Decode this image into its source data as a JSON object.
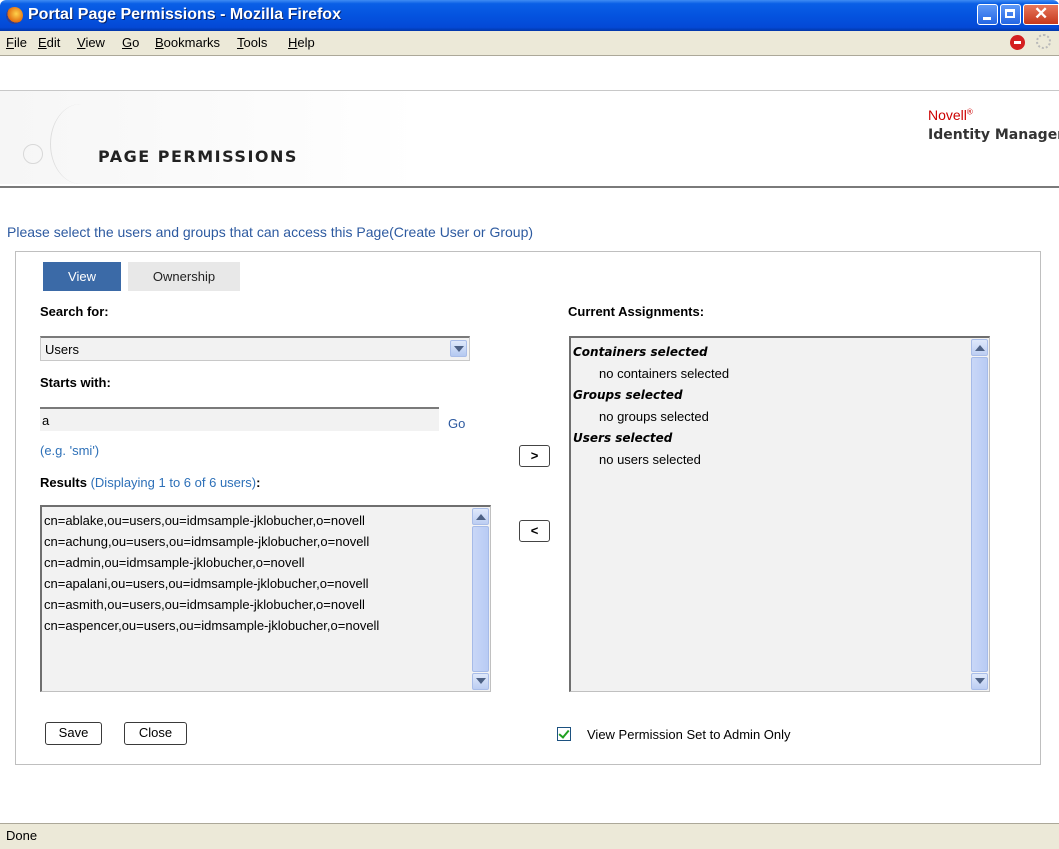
{
  "window": {
    "title": "Portal Page Permissions - Mozilla Firefox"
  },
  "menubar": {
    "items": [
      "File",
      "Edit",
      "View",
      "Go",
      "Bookmarks",
      "Tools",
      "Help"
    ]
  },
  "header": {
    "page_title": "PAGE PERMISSIONS",
    "brand": "Novell",
    "brand_mark": "®",
    "product": "Identity Manager"
  },
  "instructions": "Please select the users and groups that can access this Page(Create User or Group)",
  "tabs": [
    {
      "label": "View",
      "active": true
    },
    {
      "label": "Ownership",
      "active": false
    }
  ],
  "search": {
    "label": "Search for:",
    "selected": "Users",
    "starts_label": "Starts with:",
    "starts_value": "a",
    "go_label": "Go",
    "example": "(e.g. 'smi')"
  },
  "results": {
    "label": "Results",
    "count_text": "(Displaying 1 to 6 of 6 users)",
    "colon": ":",
    "items": [
      "cn=ablake,ou=users,ou=idmsample-jklobucher,o=novell",
      "cn=achung,ou=users,ou=idmsample-jklobucher,o=novell",
      "cn=admin,ou=idmsample-jklobucher,o=novell",
      "cn=apalani,ou=users,ou=idmsample-jklobucher,o=novell",
      "cn=asmith,ou=users,ou=idmsample-jklobucher,o=novell",
      "cn=aspencer,ou=users,ou=idmsample-jklobucher,o=novell"
    ]
  },
  "transfer": {
    "add_label": ">",
    "remove_label": "<"
  },
  "assignments": {
    "label": "Current Assignments:",
    "containers_head": "Containers selected",
    "containers_none": "no containers selected",
    "groups_head": "Groups selected",
    "groups_none": "no groups selected",
    "users_head": "Users selected",
    "users_none": "no users selected"
  },
  "actions": {
    "save": "Save",
    "close": "Close",
    "admin_only_label": "View Permission Set to Admin Only",
    "admin_only_checked": true
  },
  "status": "Done",
  "colors": {
    "titlebar": "#0453df",
    "tab_active": "#3b6aa7",
    "link": "#2d5aa0",
    "brand_red": "#cc0000"
  }
}
